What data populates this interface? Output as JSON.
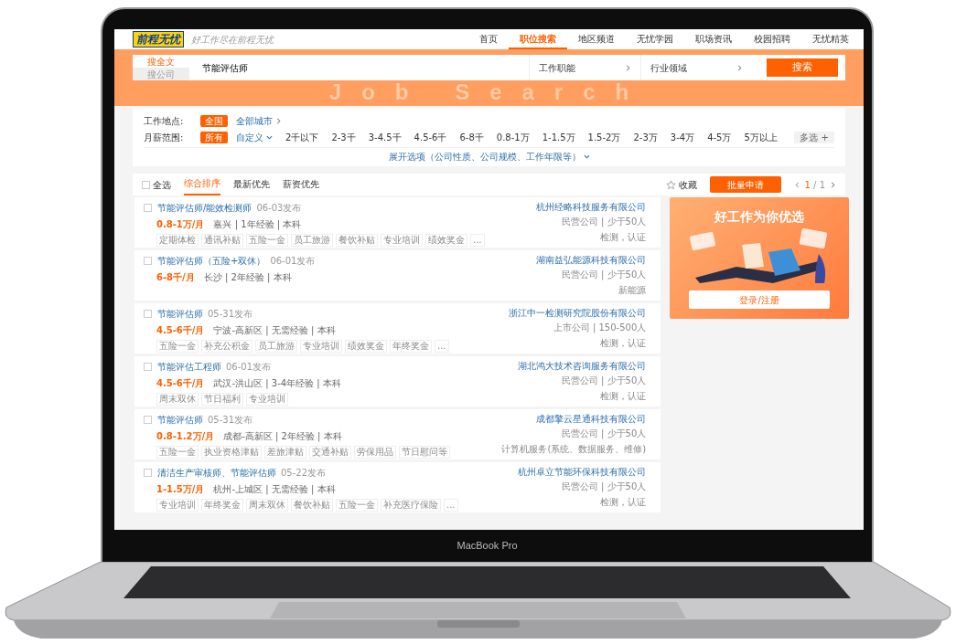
{
  "nav": {
    "logo": "前程无忧",
    "slogan": "好工作尽在前程无忧",
    "items": [
      {
        "label": "首页",
        "selected": false
      },
      {
        "label": "职位搜索",
        "selected": true
      },
      {
        "label": "地区频道",
        "selected": false
      },
      {
        "label": "无忧学园",
        "selected": false
      },
      {
        "label": "职场资讯",
        "selected": false
      },
      {
        "label": "校园招聘",
        "selected": false
      },
      {
        "label": "无忧精英",
        "selected": false
      }
    ]
  },
  "search": {
    "banner_text": "Job Search",
    "tabs": [
      {
        "label": "搜全文",
        "selected": true
      },
      {
        "label": "搜公司",
        "selected": false
      }
    ],
    "query": "节能评估师",
    "selects": [
      "工作职能",
      "行业领域"
    ],
    "button": "搜索"
  },
  "filters": [
    {
      "label": "工作地点:",
      "options": [
        {
          "label": "全国",
          "selected": true
        },
        {
          "label": "全部城市",
          "selected": false,
          "kind": "link"
        }
      ]
    },
    {
      "label": "月薪范围:",
      "options": [
        {
          "label": "所有",
          "selected": true
        },
        {
          "label": "自定义",
          "selected": false,
          "kind": "dropdown"
        },
        {
          "label": "2千以下",
          "selected": false
        },
        {
          "label": "2-3千",
          "selected": false
        },
        {
          "label": "3-4.5千",
          "selected": false
        },
        {
          "label": "4.5-6千",
          "selected": false
        },
        {
          "label": "6-8千",
          "selected": false
        },
        {
          "label": "0.8-1万",
          "selected": false
        },
        {
          "label": "1-1.5万",
          "selected": false
        },
        {
          "label": "1.5-2万",
          "selected": false
        },
        {
          "label": "2-3万",
          "selected": false
        },
        {
          "label": "3-4万",
          "selected": false
        },
        {
          "label": "4-5万",
          "selected": false
        },
        {
          "label": "5万以上",
          "selected": false
        }
      ],
      "multi": "多选 +"
    }
  ],
  "expand": "展开选项（公司性质、公司规模、工作年限等）",
  "toolbar": {
    "select_all": {
      "label": "全选",
      "checked": false
    },
    "sort_tabs": [
      {
        "label": "综合排序",
        "selected": true
      },
      {
        "label": "最新优先",
        "selected": false
      },
      {
        "label": "薪资优先",
        "selected": false
      }
    ],
    "favorite": "收藏",
    "apply_button": "批量申请",
    "page": "1",
    "total": "/ 1"
  },
  "jobs": [
    {
      "checked": false,
      "title": "节能评估师/能效检测师",
      "date": "06-03发布",
      "salary": "0.8-1万/月",
      "meta": "嘉兴 | 1年经验 | 本科",
      "company": "杭州经略科技服务有限公司",
      "company_info": "民营公司 | 少于50人",
      "industry": "检测，认证",
      "tags": [
        "定期体检",
        "通讯补贴",
        "五险一金",
        "员工旅游",
        "餐饮补贴",
        "专业培训",
        "绩效奖金",
        "..."
      ]
    },
    {
      "checked": false,
      "title": "节能评估师（五险+双休）",
      "date": "06-01发布",
      "salary": "6-8千/月",
      "meta": "长沙 | 2年经验 | 本科",
      "company": "湖南益弘能源科技有限公司",
      "company_info": "民营公司 | 少于50人",
      "industry": "新能源"
    },
    {
      "checked": false,
      "title": "节能评估师",
      "date": "05-31发布",
      "salary": "4.5-6千/月",
      "meta": "宁波-高新区 | 无需经验 | 本科",
      "company": "浙江中一检测研究院股份有限公司",
      "company_info": "上市公司 | 150-500人",
      "industry": "检测，认证",
      "tags": [
        "五险一金",
        "补充公积金",
        "员工旅游",
        "专业培训",
        "绩效奖金",
        "年终奖金",
        "..."
      ]
    },
    {
      "checked": false,
      "title": "节能评估工程师",
      "date": "06-01发布",
      "salary": "4.5-6千/月",
      "meta": "武汉-洪山区 | 3-4年经验 | 本科",
      "company": "湖北鸿大技术咨询服务有限公司",
      "company_info": "民营公司 | 少于50人",
      "industry": "检测，认证",
      "tags": [
        "周末双休",
        "节日福利",
        "专业培训"
      ]
    },
    {
      "checked": false,
      "title": "节能评估师",
      "date": "05-31发布",
      "salary": "0.8-1.2万/月",
      "meta": "成都-高新区 | 2年经验 | 本科",
      "company": "成都擎云星通科技有限公司",
      "company_info": "民营公司 | 少于50人",
      "industry": "计算机服务(系统、数据服务、维修)",
      "tags": [
        "五险一金",
        "执业资格津贴",
        "差旅津贴",
        "交通补贴",
        "劳保用品",
        "节日慰问等"
      ]
    },
    {
      "checked": false,
      "title": "清洁生产审核师、节能评估师",
      "date": "05-22发布",
      "salary": "1-1.5万/月",
      "meta": "杭州-上城区 | 无需经验 | 本科",
      "company": "杭州卓立节能环保科技有限公司",
      "company_info": "民营公司 | 少于50人",
      "industry": "检测，认证",
      "tags": [
        "专业培训",
        "年终奖金",
        "周末双休",
        "餐饮补贴",
        "五险一金",
        "补充医疗保险",
        "..."
      ]
    }
  ],
  "ad": {
    "headline": "好工作为你优选",
    "button": "登录/注册"
  },
  "laptop": {
    "label": "MacBook Pro"
  }
}
